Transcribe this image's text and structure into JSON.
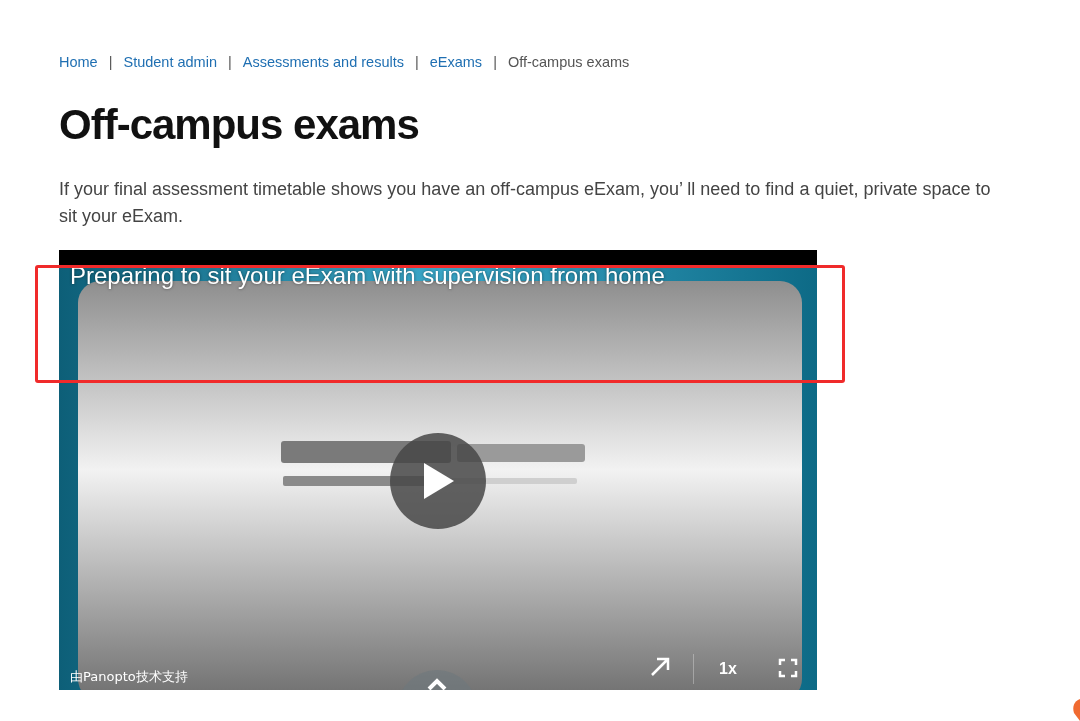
{
  "breadcrumb": [
    {
      "label": "Home",
      "current": false
    },
    {
      "separator": "|",
      "label": "Student admin",
      "current": false
    },
    {
      "separator": "|",
      "label": "Assessments and results",
      "current": false
    },
    {
      "separator": "|",
      "label": "eExams",
      "current": false
    },
    {
      "separator": "|",
      "label": "Off-campus exams",
      "current": true
    }
  ],
  "title": "Off-campus exams",
  "intro": "If your final assessment timetable shows you have an off-campus eExam, you’ ll need to find a quiet, private space to sit your eExam.",
  "video": {
    "title": "Preparing to sit your eExam with supervision from home",
    "powered_by": "由Panopto技术支持",
    "speed": "1x"
  }
}
